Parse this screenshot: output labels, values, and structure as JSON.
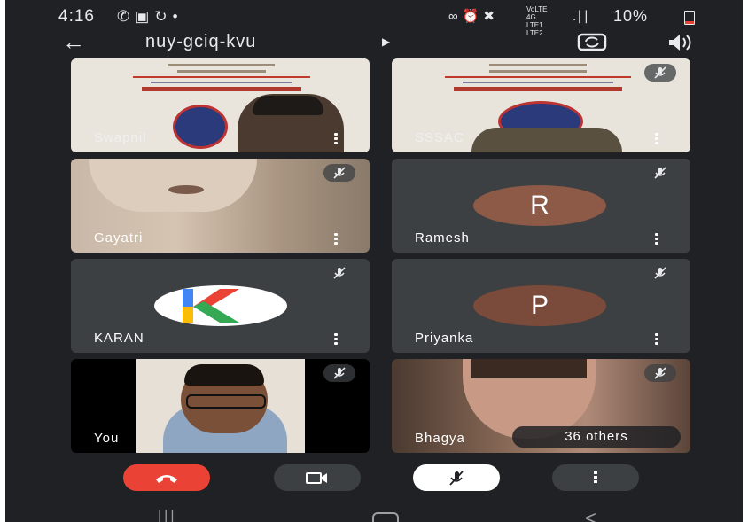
{
  "status_bar": {
    "time": "4:16",
    "battery_percent": "10%",
    "network_label": "VoLTE 4G LTE1 LTE2",
    "left_icons": [
      "whatsapp-icon",
      "image-icon",
      "sync-icon",
      "dot-icon"
    ],
    "right_icons": [
      "vpn-icon",
      "alarm-icon",
      "mute-icon",
      "signal-icon",
      "battery-icon"
    ]
  },
  "app_bar": {
    "meeting_code": "nuy-gciq-kvu",
    "back_icon": "arrow-left-icon",
    "flip_camera_icon": "flip-camera-icon",
    "speaker_icon": "speaker-icon"
  },
  "participants": [
    {
      "name": "Swapnil",
      "kind": "video",
      "muted": false
    },
    {
      "name": "SSSAC",
      "kind": "video",
      "muted": true
    },
    {
      "name": "Gayatri",
      "kind": "video",
      "muted": true
    },
    {
      "name": "Ramesh",
      "kind": "avatar",
      "initial": "R",
      "avatar_color": "#8d5a47",
      "muted": true
    },
    {
      "name": "KARAN",
      "kind": "logo",
      "muted": true
    },
    {
      "name": "Priyanka",
      "kind": "avatar",
      "initial": "P",
      "avatar_color": "#7a4a3a",
      "muted": true
    },
    {
      "name": "You",
      "kind": "self-video",
      "muted": true
    },
    {
      "name": "Bhagya",
      "kind": "video",
      "muted": true,
      "others_label": "36 others"
    }
  ],
  "controls": {
    "end_call_icon": "phone-hangup-icon",
    "camera_icon": "video-camera-icon",
    "mic_icon": "mic-off-icon",
    "more_icon": "more-vert-icon",
    "end_call_color": "#ea4335"
  },
  "nav_bar": {
    "recents_icon": "recents-icon",
    "home_icon": "home-icon",
    "back_icon": "back-chevron-icon"
  },
  "colors": {
    "background": "#202124",
    "tile": "#3c4043",
    "text": "#e8eaed"
  }
}
